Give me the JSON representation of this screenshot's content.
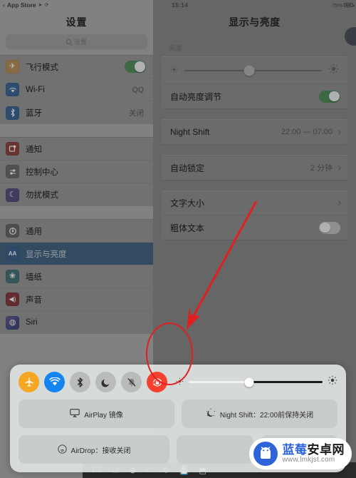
{
  "status_bar": {
    "back_arrow": "‹",
    "app_name": "App Store",
    "location_icon": "location-icon",
    "time": "15:14",
    "battery_percent": "75%"
  },
  "sidebar": {
    "title": "设置",
    "search": {
      "placeholder": "设置",
      "icon": "search-icon"
    },
    "groups": [
      {
        "items": [
          {
            "label": "飞行模式",
            "icon": "airplane-icon",
            "icon_color": "#d8912a",
            "glyph": "✈",
            "control": "toggle",
            "toggle_on": true
          },
          {
            "label": "Wi-Fi",
            "icon": "wifi-icon",
            "icon_color": "#1f6fc4",
            "glyph": "▲",
            "value": "QQ"
          },
          {
            "label": "蓝牙",
            "icon": "bluetooth-icon",
            "icon_color": "#1f6fc4",
            "glyph": "✦",
            "value": "关闭"
          }
        ]
      },
      {
        "items": [
          {
            "label": "通知",
            "icon": "notifications-icon",
            "icon_color": "#c33a33",
            "glyph": "◲"
          },
          {
            "label": "控制中心",
            "icon": "control-center-icon",
            "icon_color": "#6f6f6f",
            "glyph": "◉"
          },
          {
            "label": "勿扰模式",
            "icon": "do-not-disturb-icon",
            "icon_color": "#5b4fa8",
            "glyph": "☾"
          }
        ]
      },
      {
        "items": [
          {
            "label": "通用",
            "icon": "general-gear-icon",
            "icon_color": "#6b6b6b",
            "glyph": "⚙"
          },
          {
            "label": "显示与亮度",
            "icon": "display-brightness-icon",
            "icon_color": "#2667b8",
            "glyph": "AA",
            "selected": true
          },
          {
            "label": "墙纸",
            "icon": "wallpaper-icon",
            "icon_color": "#2b7f85",
            "glyph": "❀"
          },
          {
            "label": "声音",
            "icon": "sound-icon",
            "icon_color": "#b8303a",
            "glyph": "◀)"
          },
          {
            "label": "Siri",
            "icon": "siri-icon",
            "icon_color": "#5a4ea0",
            "glyph": "◍"
          }
        ]
      }
    ]
  },
  "detail": {
    "title": "显示与亮度",
    "brightness_section_label": "亮度",
    "brightness_slider": {
      "name": "brightness-slider",
      "value_percent": 47,
      "low_icon": "sun-small-icon",
      "high_icon": "sun-large-icon"
    },
    "auto_brightness": {
      "label": "自动亮度调节",
      "toggle_on": true
    },
    "rows": [
      {
        "label": "Night Shift",
        "value": "22:00 — 07:00",
        "chevron": true
      },
      {
        "label": "自动锁定",
        "value": "2 分钟",
        "chevron": true
      },
      {
        "label": "文字大小",
        "value": "",
        "chevron": true
      },
      {
        "label": "粗体文本",
        "control": "toggle",
        "toggle_on": false
      }
    ]
  },
  "control_center": {
    "toggles": [
      {
        "name": "airplane-mode-button",
        "glyph": "✈",
        "style": "orange",
        "active": true
      },
      {
        "name": "wifi-button",
        "glyph": "▲",
        "style": "blue",
        "active": true
      },
      {
        "name": "bluetooth-button",
        "glyph": "✦",
        "style": "grey",
        "active": false
      },
      {
        "name": "do-not-disturb-button",
        "glyph": "☾",
        "style": "grey",
        "active": false
      },
      {
        "name": "mute-button",
        "glyph": "🔔",
        "style": "grey",
        "active": false
      },
      {
        "name": "rotation-lock-button",
        "glyph": "🔒",
        "style": "red",
        "active": true,
        "highlighted": true
      }
    ],
    "brightness": {
      "name": "cc-brightness-slider",
      "value_percent": 45,
      "low_icon": "sun-small-icon",
      "high_icon": "sun-large-icon"
    },
    "tiles_row1": [
      {
        "name": "airplay-mirroring-tile",
        "icon": "airplay-icon",
        "label": "AirPlay 镜像"
      },
      {
        "name": "night-shift-tile",
        "icon": "night-shift-icon",
        "label": "Night Shift：22:00前保持关闭"
      }
    ],
    "tiles_row2": [
      {
        "name": "airdrop-tile",
        "icon": "airdrop-icon",
        "label": "AirDrop：接收关闭"
      },
      {
        "name": "cc-tile-blank-1",
        "icon": "",
        "label": ""
      },
      {
        "name": "cc-tile-blank-2",
        "icon": "",
        "label": ""
      }
    ]
  },
  "dock": {
    "items": [
      "1:1",
      "▭",
      "⊕",
      "◠",
      "↻",
      "💾",
      "⬒"
    ]
  },
  "annotation": {
    "arrow_color": "#e02020",
    "ellipse_color": "#e02020"
  },
  "watermark": {
    "brand_blue": "蓝莓",
    "brand_black": "安卓网",
    "url": "www.lmkjst.com",
    "logo": "android-robot-icon",
    "accent": "#2f64d8"
  }
}
